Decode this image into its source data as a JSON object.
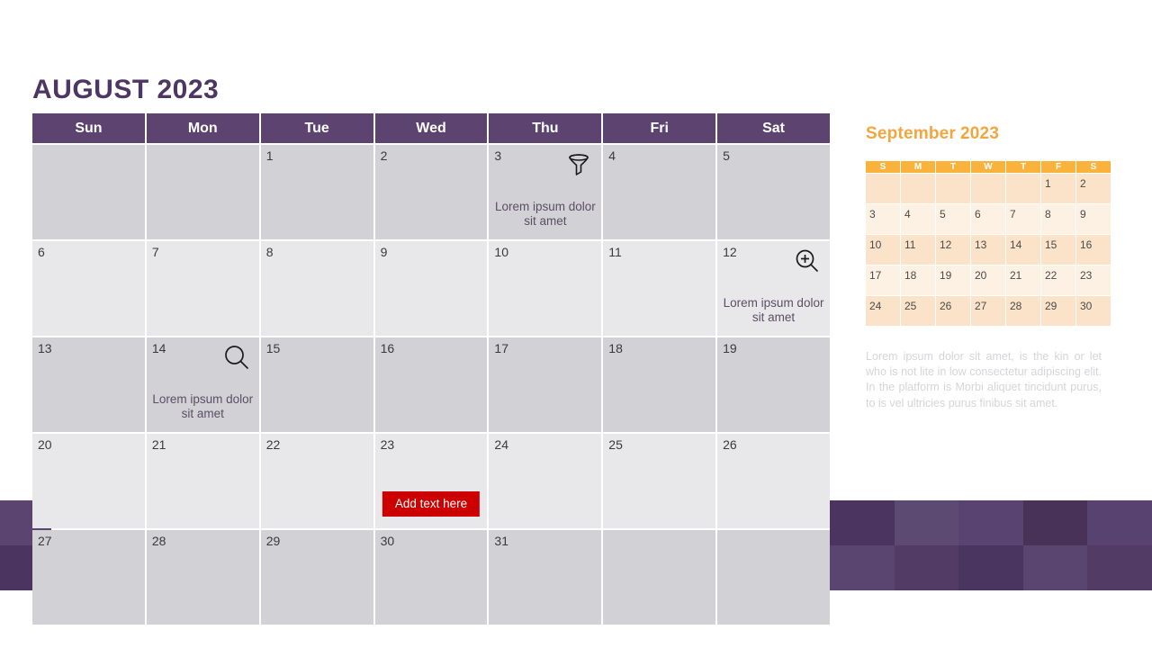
{
  "slide": {
    "title": "AUGUST 2023",
    "title_color": "#4d3663",
    "accent_purple": "#5c4370",
    "accent_orange": "#f9b23c",
    "button_red": "#cc0000"
  },
  "main_calendar": {
    "weekday_headers": [
      "Sun",
      "Mon",
      "Tue",
      "Wed",
      "Thu",
      "Fri",
      "Sat"
    ],
    "weeks": [
      [
        {
          "day": "",
          "note": "",
          "icon": "",
          "button": ""
        },
        {
          "day": "",
          "note": "",
          "icon": "",
          "button": ""
        },
        {
          "day": "1",
          "note": "",
          "icon": "",
          "button": ""
        },
        {
          "day": "2",
          "note": "",
          "icon": "",
          "button": ""
        },
        {
          "day": "3",
          "note": "Lorem ipsum dolor sit amet",
          "icon": "filter-funnel-icon",
          "button": ""
        },
        {
          "day": "4",
          "note": "",
          "icon": "",
          "button": ""
        },
        {
          "day": "5",
          "note": "",
          "icon": "",
          "button": ""
        }
      ],
      [
        {
          "day": "6",
          "note": "",
          "icon": "",
          "button": ""
        },
        {
          "day": "7",
          "note": "",
          "icon": "",
          "button": ""
        },
        {
          "day": "8",
          "note": "",
          "icon": "",
          "button": ""
        },
        {
          "day": "9",
          "note": "",
          "icon": "",
          "button": ""
        },
        {
          "day": "10",
          "note": "",
          "icon": "",
          "button": ""
        },
        {
          "day": "11",
          "note": "",
          "icon": "",
          "button": ""
        },
        {
          "day": "12",
          "note": "Lorem ipsum dolor sit amet",
          "icon": "zoom-in-icon",
          "button": ""
        }
      ],
      [
        {
          "day": "13",
          "note": "",
          "icon": "",
          "button": ""
        },
        {
          "day": "14",
          "note": "Lorem ipsum dolor sit amet",
          "icon": "search-icon",
          "button": ""
        },
        {
          "day": "15",
          "note": "",
          "icon": "",
          "button": ""
        },
        {
          "day": "16",
          "note": "",
          "icon": "",
          "button": ""
        },
        {
          "day": "17",
          "note": "",
          "icon": "",
          "button": ""
        },
        {
          "day": "18",
          "note": "",
          "icon": "",
          "button": ""
        },
        {
          "day": "19",
          "note": "",
          "icon": "",
          "button": ""
        }
      ],
      [
        {
          "day": "20",
          "note": "",
          "icon": "",
          "button": ""
        },
        {
          "day": "21",
          "note": "",
          "icon": "",
          "button": ""
        },
        {
          "day": "22",
          "note": "",
          "icon": "",
          "button": ""
        },
        {
          "day": "23",
          "note": "",
          "icon": "",
          "button": "Add text here"
        },
        {
          "day": "24",
          "note": "",
          "icon": "",
          "button": ""
        },
        {
          "day": "25",
          "note": "",
          "icon": "",
          "button": ""
        },
        {
          "day": "26",
          "note": "",
          "icon": "",
          "button": ""
        }
      ],
      [
        {
          "day": "27",
          "note": "",
          "icon": "",
          "button": ""
        },
        {
          "day": "28",
          "note": "",
          "icon": "",
          "button": ""
        },
        {
          "day": "29",
          "note": "",
          "icon": "",
          "button": ""
        },
        {
          "day": "30",
          "note": "",
          "icon": "",
          "button": ""
        },
        {
          "day": "31",
          "note": "",
          "icon": "",
          "button": ""
        },
        {
          "day": "",
          "note": "",
          "icon": "",
          "button": ""
        },
        {
          "day": "",
          "note": "",
          "icon": "",
          "button": ""
        }
      ]
    ]
  },
  "side_panel": {
    "mini_month": "September",
    "mini_year": "2023",
    "weekday_headers": [
      "S",
      "M",
      "T",
      "W",
      "T",
      "F",
      "S"
    ],
    "weeks": [
      [
        "",
        "",
        "",
        "",
        "",
        "1",
        "2"
      ],
      [
        "3",
        "4",
        "5",
        "6",
        "7",
        "8",
        "9"
      ],
      [
        "10",
        "11",
        "12",
        "13",
        "14",
        "15",
        "16"
      ],
      [
        "17",
        "18",
        "19",
        "20",
        "21",
        "22",
        "23"
      ],
      [
        "24",
        "25",
        "26",
        "27",
        "28",
        "29",
        "30"
      ]
    ],
    "note": "Lorem ipsum dolor sit amet, is the kin or let who is not lite   in low consectetur adipiscing elit. In the platform is Morbi aliquet tincidunt purus, to is vel ultricies purus finibus sit amet."
  },
  "decor": {
    "left_blocks": [
      "#5c4470",
      "#4b3560"
    ],
    "right_blocks": [
      "#4b3560",
      "#5d4a73",
      "#594370",
      "#483258",
      "#584370",
      "#5a4570",
      "#523c66",
      "#4a3460",
      "#5a4570",
      "#523c66"
    ]
  }
}
